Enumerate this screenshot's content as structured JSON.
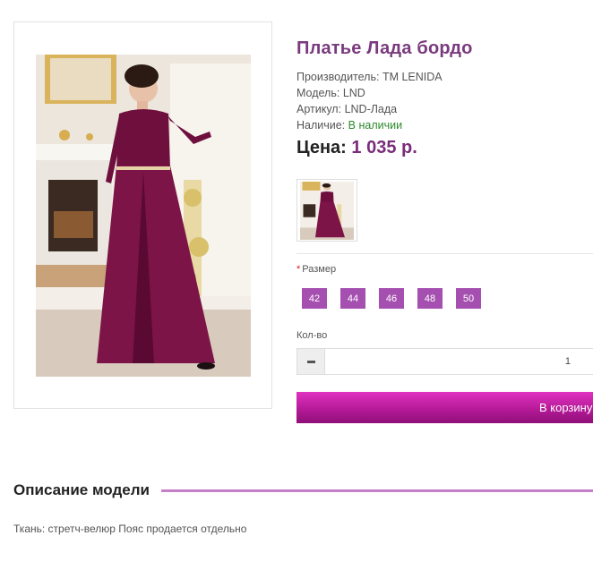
{
  "product": {
    "title": "Платье Лада бордо",
    "manufacturer_label": "Производитель:",
    "manufacturer_value": "ТМ LENIDA",
    "model_label": "Модель:",
    "model_value": "LND",
    "sku_label": "Артикул:",
    "sku_value": "LND-Лада",
    "availability_label": "Наличие:",
    "availability_value": "В наличии",
    "price_label": "Цена:",
    "price_value": "1 035 р."
  },
  "options": {
    "size_required_mark": "*",
    "size_label": "Размер",
    "sizes": [
      "42",
      "44",
      "46",
      "48",
      "50"
    ],
    "qty_label": "Кол-во",
    "qty_value": "1"
  },
  "actions": {
    "add_to_cart": "В корзину"
  },
  "description": {
    "heading": "Описание модели",
    "text": "Ткань: стретч-велюр Пояс продается отдельно"
  },
  "colors": {
    "title": "#7a3a7e",
    "price": "#7a2d78",
    "in_stock": "#2c8a2c",
    "size_button": "#a54fb0",
    "cart_button": "#b51a99",
    "heading_rule": "#c57ec8"
  }
}
